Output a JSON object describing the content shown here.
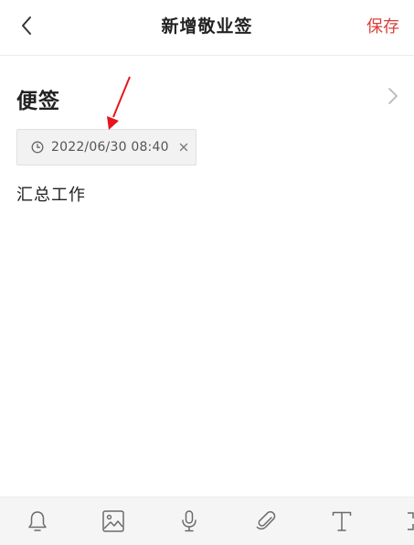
{
  "header": {
    "back_icon": "chevron-left-icon",
    "title": "新增敬业签",
    "save_label": "保存"
  },
  "note": {
    "title": "便签",
    "category_icon": "chevron-right-icon",
    "reminder": {
      "icon": "clock-icon",
      "datetime": "2022/06/30 08:40",
      "close_icon": "close-icon"
    },
    "body": "汇总工作"
  },
  "toolbar": {
    "items": [
      {
        "icon": "bell-icon"
      },
      {
        "icon": "image-icon"
      },
      {
        "icon": "microphone-icon"
      },
      {
        "icon": "paperclip-icon"
      },
      {
        "icon": "text-format-icon"
      },
      {
        "icon": "expand-icon"
      }
    ]
  },
  "colors": {
    "accent": "#d8413a",
    "annotation": "#e8141c",
    "text": "#222222",
    "icon": "#6b6b6b",
    "chip_bg": "#f2f2f2",
    "toolbar_bg": "#f5f5f5"
  }
}
